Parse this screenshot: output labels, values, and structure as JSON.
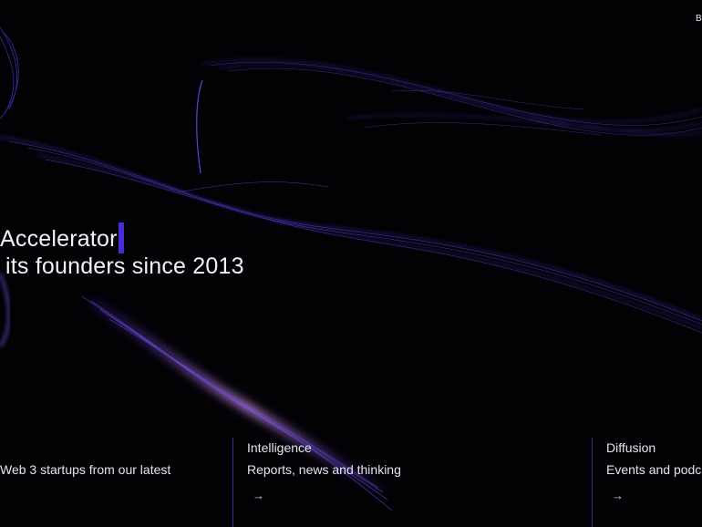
{
  "header": {
    "nav_text": "B"
  },
  "hero": {
    "line1": "Accelerator",
    "line2": "its founders since 2013",
    "cursor_color": "#4b2bd6"
  },
  "cards": [
    {
      "title": "",
      "desc": "Web 3 startups from our latest"
    },
    {
      "title": "Intelligence",
      "desc": "Reports, news and thinking",
      "arrow": "→"
    },
    {
      "title": "Diffusion",
      "desc": "Events and podcasts",
      "arrow": "→"
    }
  ],
  "colors": {
    "background": "#020104",
    "accent": "#4b2bd6",
    "stream": "#6a48ff",
    "stream_glow": "#e9a8ff"
  }
}
